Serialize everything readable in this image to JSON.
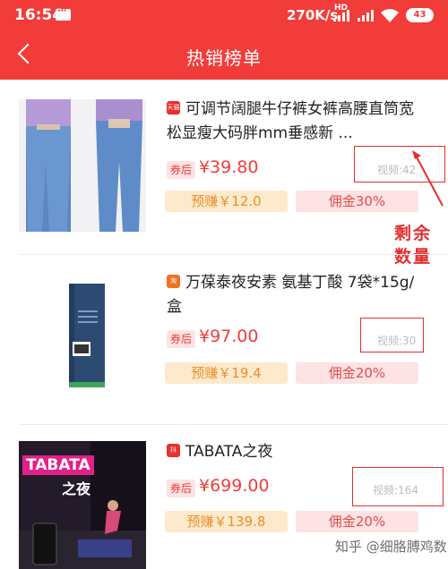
{
  "status_bar": {
    "time": "16:54",
    "net_speed": "270K/s",
    "hd": "HD",
    "battery": "43"
  },
  "nav": {
    "title": "热销榜单"
  },
  "colors": {
    "brand_red": "#f23c3a",
    "earn_bg": "#fde9cc",
    "earn_text": "#e8912a"
  },
  "items": [
    {
      "shop_icon": "天猫",
      "name": "可调节阔腿牛仔裤女裤高腰直筒宽松显瘦大码胖mm垂感新 ...",
      "coupon_label": "券后",
      "price": "¥39.80",
      "video": "视频:42",
      "earn": "预赚￥12.0",
      "commission": "佣金30%"
    },
    {
      "shop_icon": "淘",
      "name": "万葆泰夜安素 氨基丁酸 7袋*15g/盒",
      "coupon_label": "券后",
      "price": "¥97.00",
      "video": "视频:30",
      "earn": "预赚￥19.4",
      "commission": "佣金20%"
    },
    {
      "shop_icon": "抖",
      "name": "TABATA之夜",
      "coupon_label": "券后",
      "price": "¥699.00",
      "video": "视频:164",
      "earn": "预赚￥139.8",
      "commission": "佣金20%"
    }
  ],
  "product3_image_text": {
    "line1": "TABATA",
    "line2": "之夜"
  },
  "annotation": {
    "line1": "剩余",
    "line2": "数量"
  },
  "watermark": "知乎 @细胳膊鸡数"
}
